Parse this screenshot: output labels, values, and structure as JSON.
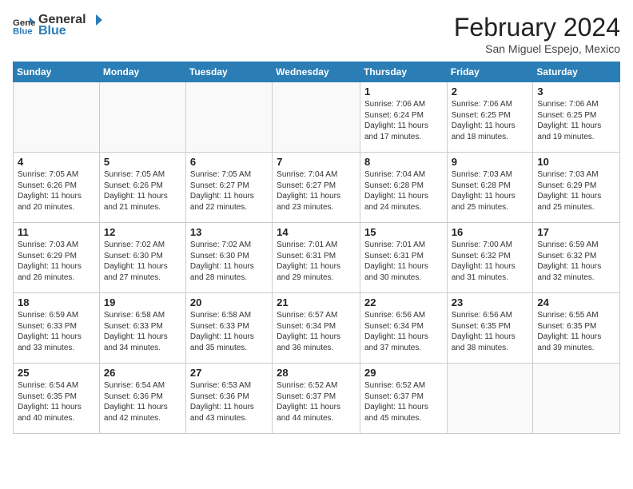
{
  "logo": {
    "general": "General",
    "blue": "Blue"
  },
  "header": {
    "title": "February 2024",
    "subtitle": "San Miguel Espejo, Mexico"
  },
  "days_of_week": [
    "Sunday",
    "Monday",
    "Tuesday",
    "Wednesday",
    "Thursday",
    "Friday",
    "Saturday"
  ],
  "weeks": [
    [
      {
        "day": "",
        "info": ""
      },
      {
        "day": "",
        "info": ""
      },
      {
        "day": "",
        "info": ""
      },
      {
        "day": "",
        "info": ""
      },
      {
        "day": "1",
        "sunrise": "Sunrise: 7:06 AM",
        "sunset": "Sunset: 6:24 PM",
        "daylight": "Daylight: 11 hours and 17 minutes."
      },
      {
        "day": "2",
        "sunrise": "Sunrise: 7:06 AM",
        "sunset": "Sunset: 6:25 PM",
        "daylight": "Daylight: 11 hours and 18 minutes."
      },
      {
        "day": "3",
        "sunrise": "Sunrise: 7:06 AM",
        "sunset": "Sunset: 6:25 PM",
        "daylight": "Daylight: 11 hours and 19 minutes."
      }
    ],
    [
      {
        "day": "4",
        "sunrise": "Sunrise: 7:05 AM",
        "sunset": "Sunset: 6:26 PM",
        "daylight": "Daylight: 11 hours and 20 minutes."
      },
      {
        "day": "5",
        "sunrise": "Sunrise: 7:05 AM",
        "sunset": "Sunset: 6:26 PM",
        "daylight": "Daylight: 11 hours and 21 minutes."
      },
      {
        "day": "6",
        "sunrise": "Sunrise: 7:05 AM",
        "sunset": "Sunset: 6:27 PM",
        "daylight": "Daylight: 11 hours and 22 minutes."
      },
      {
        "day": "7",
        "sunrise": "Sunrise: 7:04 AM",
        "sunset": "Sunset: 6:27 PM",
        "daylight": "Daylight: 11 hours and 23 minutes."
      },
      {
        "day": "8",
        "sunrise": "Sunrise: 7:04 AM",
        "sunset": "Sunset: 6:28 PM",
        "daylight": "Daylight: 11 hours and 24 minutes."
      },
      {
        "day": "9",
        "sunrise": "Sunrise: 7:03 AM",
        "sunset": "Sunset: 6:28 PM",
        "daylight": "Daylight: 11 hours and 25 minutes."
      },
      {
        "day": "10",
        "sunrise": "Sunrise: 7:03 AM",
        "sunset": "Sunset: 6:29 PM",
        "daylight": "Daylight: 11 hours and 25 minutes."
      }
    ],
    [
      {
        "day": "11",
        "sunrise": "Sunrise: 7:03 AM",
        "sunset": "Sunset: 6:29 PM",
        "daylight": "Daylight: 11 hours and 26 minutes."
      },
      {
        "day": "12",
        "sunrise": "Sunrise: 7:02 AM",
        "sunset": "Sunset: 6:30 PM",
        "daylight": "Daylight: 11 hours and 27 minutes."
      },
      {
        "day": "13",
        "sunrise": "Sunrise: 7:02 AM",
        "sunset": "Sunset: 6:30 PM",
        "daylight": "Daylight: 11 hours and 28 minutes."
      },
      {
        "day": "14",
        "sunrise": "Sunrise: 7:01 AM",
        "sunset": "Sunset: 6:31 PM",
        "daylight": "Daylight: 11 hours and 29 minutes."
      },
      {
        "day": "15",
        "sunrise": "Sunrise: 7:01 AM",
        "sunset": "Sunset: 6:31 PM",
        "daylight": "Daylight: 11 hours and 30 minutes."
      },
      {
        "day": "16",
        "sunrise": "Sunrise: 7:00 AM",
        "sunset": "Sunset: 6:32 PM",
        "daylight": "Daylight: 11 hours and 31 minutes."
      },
      {
        "day": "17",
        "sunrise": "Sunrise: 6:59 AM",
        "sunset": "Sunset: 6:32 PM",
        "daylight": "Daylight: 11 hours and 32 minutes."
      }
    ],
    [
      {
        "day": "18",
        "sunrise": "Sunrise: 6:59 AM",
        "sunset": "Sunset: 6:33 PM",
        "daylight": "Daylight: 11 hours and 33 minutes."
      },
      {
        "day": "19",
        "sunrise": "Sunrise: 6:58 AM",
        "sunset": "Sunset: 6:33 PM",
        "daylight": "Daylight: 11 hours and 34 minutes."
      },
      {
        "day": "20",
        "sunrise": "Sunrise: 6:58 AM",
        "sunset": "Sunset: 6:33 PM",
        "daylight": "Daylight: 11 hours and 35 minutes."
      },
      {
        "day": "21",
        "sunrise": "Sunrise: 6:57 AM",
        "sunset": "Sunset: 6:34 PM",
        "daylight": "Daylight: 11 hours and 36 minutes."
      },
      {
        "day": "22",
        "sunrise": "Sunrise: 6:56 AM",
        "sunset": "Sunset: 6:34 PM",
        "daylight": "Daylight: 11 hours and 37 minutes."
      },
      {
        "day": "23",
        "sunrise": "Sunrise: 6:56 AM",
        "sunset": "Sunset: 6:35 PM",
        "daylight": "Daylight: 11 hours and 38 minutes."
      },
      {
        "day": "24",
        "sunrise": "Sunrise: 6:55 AM",
        "sunset": "Sunset: 6:35 PM",
        "daylight": "Daylight: 11 hours and 39 minutes."
      }
    ],
    [
      {
        "day": "25",
        "sunrise": "Sunrise: 6:54 AM",
        "sunset": "Sunset: 6:35 PM",
        "daylight": "Daylight: 11 hours and 40 minutes."
      },
      {
        "day": "26",
        "sunrise": "Sunrise: 6:54 AM",
        "sunset": "Sunset: 6:36 PM",
        "daylight": "Daylight: 11 hours and 42 minutes."
      },
      {
        "day": "27",
        "sunrise": "Sunrise: 6:53 AM",
        "sunset": "Sunset: 6:36 PM",
        "daylight": "Daylight: 11 hours and 43 minutes."
      },
      {
        "day": "28",
        "sunrise": "Sunrise: 6:52 AM",
        "sunset": "Sunset: 6:37 PM",
        "daylight": "Daylight: 11 hours and 44 minutes."
      },
      {
        "day": "29",
        "sunrise": "Sunrise: 6:52 AM",
        "sunset": "Sunset: 6:37 PM",
        "daylight": "Daylight: 11 hours and 45 minutes."
      },
      {
        "day": "",
        "info": ""
      },
      {
        "day": "",
        "info": ""
      }
    ]
  ]
}
